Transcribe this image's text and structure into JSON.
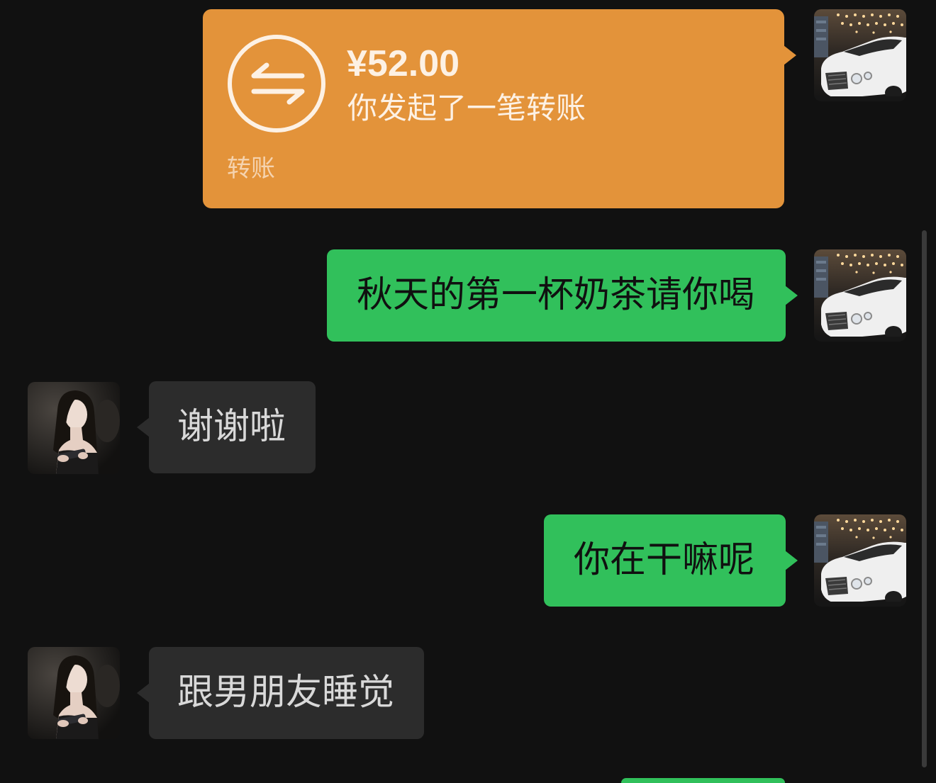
{
  "theme": {
    "background": "#111111",
    "sent_bubble": "#31C05B",
    "received_bubble": "#2C2C2C",
    "transfer_card": "#E3933A",
    "sent_text": "#101010",
    "received_text": "#D9D9D9",
    "card_text": "#FDF1E4",
    "card_label": "#F5D3AF",
    "scrollbar": "#3A3A3A"
  },
  "icons": {
    "transfer": "transfer-icon",
    "self_avatar": "car-photo-avatar",
    "contact_avatar": "portrait-photo-avatar"
  },
  "messages": [
    {
      "type": "transfer",
      "sender": "self",
      "amount": "¥52.00",
      "description": "你发起了一笔转账",
      "footer_label": "转账"
    },
    {
      "type": "text",
      "sender": "self",
      "text": "秋天的第一杯奶茶请你喝"
    },
    {
      "type": "text",
      "sender": "contact",
      "text": "谢谢啦"
    },
    {
      "type": "text",
      "sender": "self",
      "text": "你在干嘛呢"
    },
    {
      "type": "text",
      "sender": "contact",
      "text": "跟男朋友睡觉"
    },
    {
      "type": "text",
      "sender": "self"
    }
  ]
}
